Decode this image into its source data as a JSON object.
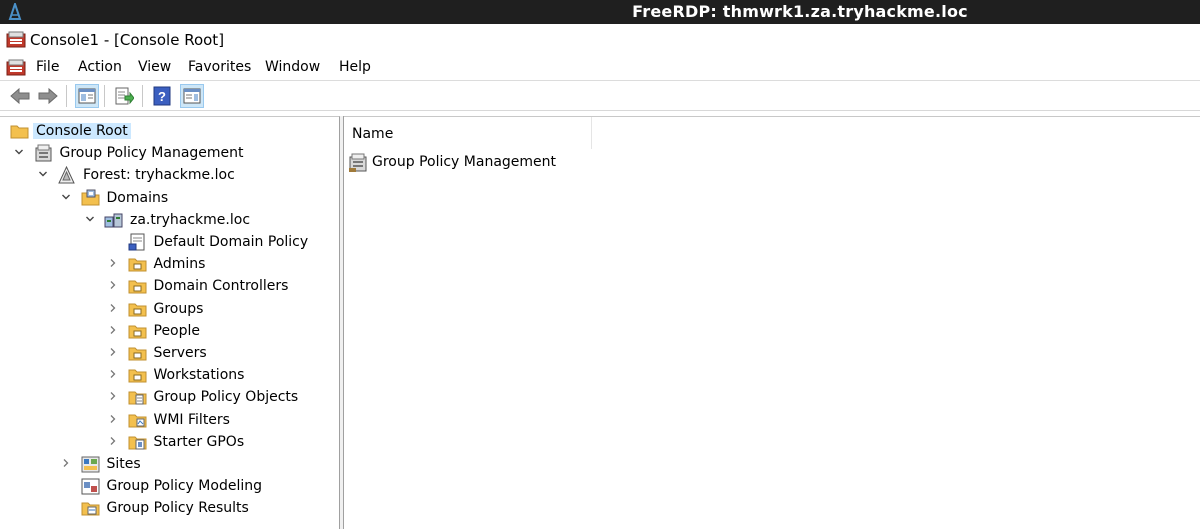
{
  "rdp": {
    "title": "FreeRDP: thmwrk1.za.tryhackme.loc"
  },
  "window": {
    "title": "Console1 - [Console Root]"
  },
  "menu": {
    "items": [
      "File",
      "Action",
      "View",
      "Favorites",
      "Window",
      "Help"
    ]
  },
  "toolbar": {
    "buttons": [
      "back-icon",
      "forward-icon",
      "show-hide-tree-icon",
      "export-list-icon",
      "help-icon",
      "show-hide-action-pane-icon"
    ]
  },
  "tree": {
    "items": [
      {
        "label": "Console Root",
        "icon": "folder-icon",
        "level": 0,
        "expanded": null,
        "selected": true
      },
      {
        "label": "Group Policy Management",
        "icon": "gpm-snapin-icon",
        "level": 1,
        "expanded": true
      },
      {
        "label": "Forest: tryhackme.loc",
        "icon": "forest-icon",
        "level": 2,
        "expanded": true
      },
      {
        "label": "Domains",
        "icon": "domains-folder-icon",
        "level": 3,
        "expanded": true
      },
      {
        "label": "za.tryhackme.loc",
        "icon": "domain-icon",
        "level": 4,
        "expanded": true
      },
      {
        "label": "Default Domain Policy",
        "icon": "gpo-link-icon",
        "level": 5,
        "expanded": null
      },
      {
        "label": "Admins",
        "icon": "ou-folder-icon",
        "level": 5,
        "expanded": false
      },
      {
        "label": "Domain Controllers",
        "icon": "ou-folder-icon",
        "level": 5,
        "expanded": false
      },
      {
        "label": "Groups",
        "icon": "ou-folder-icon",
        "level": 5,
        "expanded": false
      },
      {
        "label": "People",
        "icon": "ou-folder-icon",
        "level": 5,
        "expanded": false
      },
      {
        "label": "Servers",
        "icon": "ou-folder-icon",
        "level": 5,
        "expanded": false
      },
      {
        "label": "Workstations",
        "icon": "ou-folder-icon",
        "level": 5,
        "expanded": false
      },
      {
        "label": "Group Policy Objects",
        "icon": "gpo-folder-icon",
        "level": 5,
        "expanded": false
      },
      {
        "label": "WMI Filters",
        "icon": "wmi-folder-icon",
        "level": 5,
        "expanded": false
      },
      {
        "label": "Starter GPOs",
        "icon": "starter-gpo-folder-icon",
        "level": 5,
        "expanded": false
      },
      {
        "label": "Sites",
        "icon": "sites-icon",
        "level": 3,
        "expanded": false
      },
      {
        "label": "Group Policy Modeling",
        "icon": "gp-modeling-icon",
        "level": 3,
        "expanded": null
      },
      {
        "label": "Group Policy Results",
        "icon": "gp-results-icon",
        "level": 3,
        "expanded": null
      }
    ]
  },
  "list": {
    "column_name": "Name",
    "items": [
      {
        "label": "Group Policy Management",
        "icon": "gpm-snapin-icon"
      }
    ]
  },
  "colors": {
    "rdp_bar": "#1f1f1f",
    "selection": "#cce8ff",
    "toggle_pressed": "#cde6f7",
    "folder": "#f3c04e"
  }
}
